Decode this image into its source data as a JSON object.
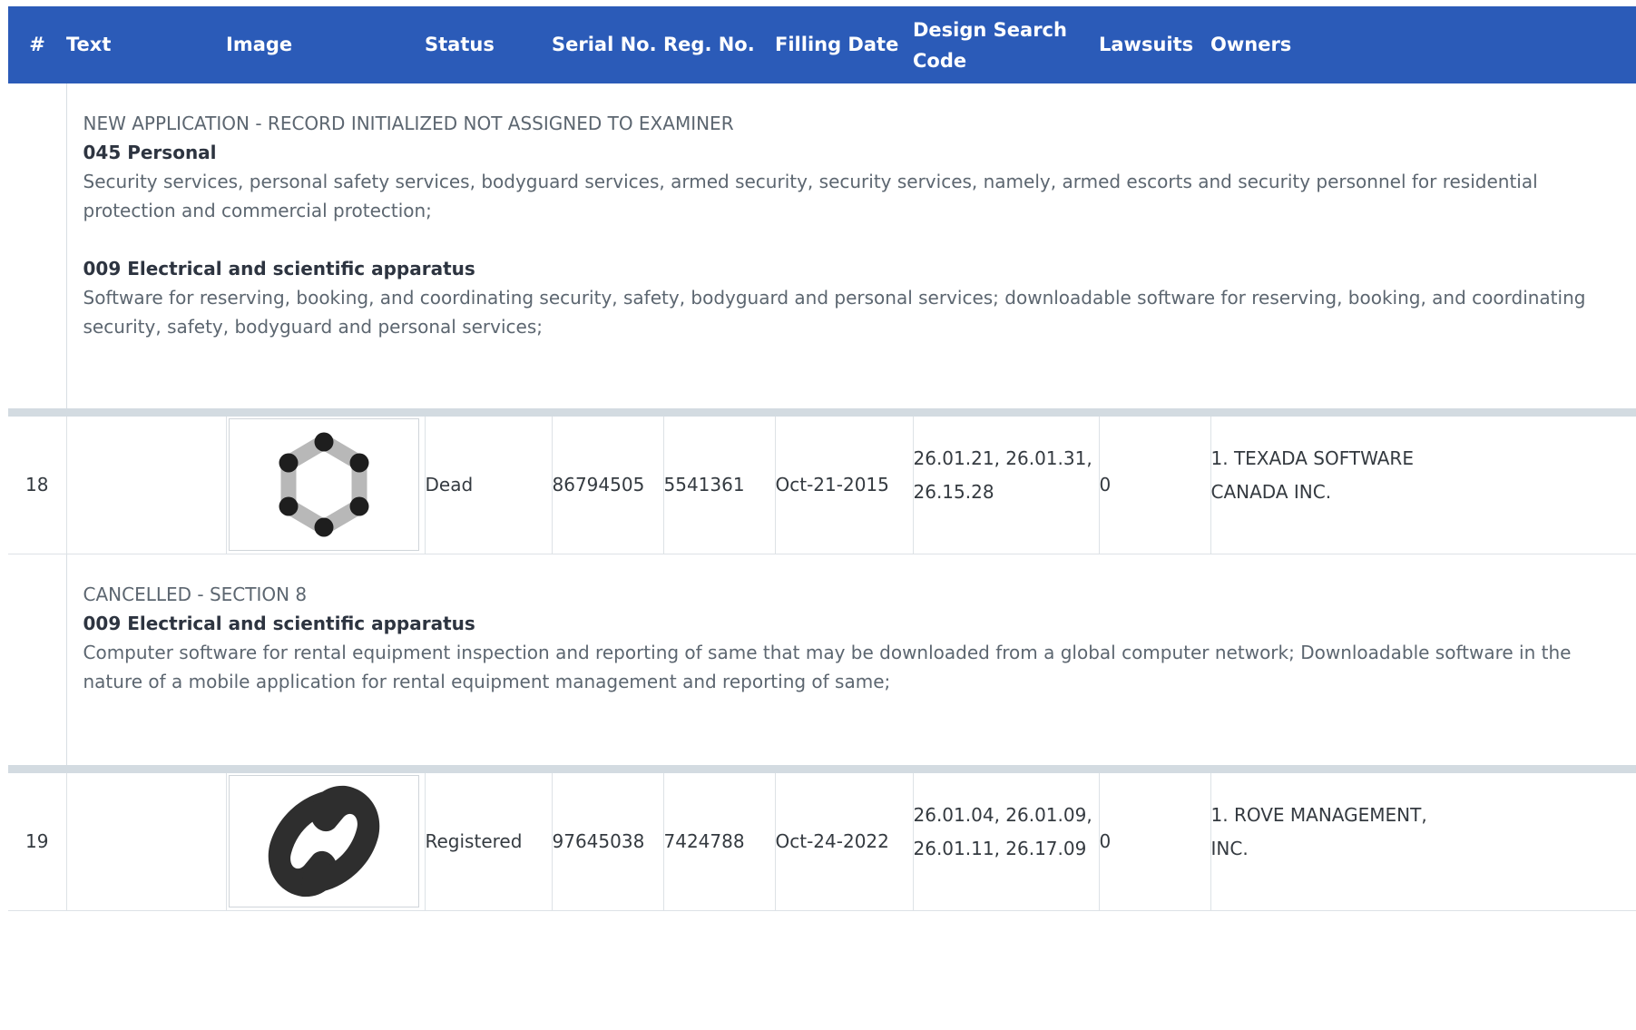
{
  "headers": {
    "num": "#",
    "text": "Text",
    "image": "Image",
    "status": "Status",
    "serial": "Serial No.",
    "reg": "Reg. No.",
    "filing": "Filling Date",
    "design_line1": "Design Search",
    "design_line2": "Code",
    "lawsuits": "Lawsuits",
    "owners": "Owners"
  },
  "details": [
    {
      "status_text": "NEW APPLICATION - RECORD INITIALIZED NOT ASSIGNED TO EXAMINER",
      "classes": [
        {
          "title": "045 Personal",
          "description": "Security services, personal safety services, bodyguard services, armed security, security services, namely, armed escorts and security personnel for residential protection and commercial protection;"
        },
        {
          "title": "009 Electrical and scientific apparatus",
          "description": "Software for reserving, booking, and coordinating security, safety, bodyguard and personal services; downloadable software for reserving, booking, and coordinating security, safety, bodyguard and personal services;"
        }
      ]
    },
    {
      "status_text": "CANCELLED - SECTION 8",
      "classes": [
        {
          "title": "009 Electrical and scientific apparatus",
          "description": "Computer software for rental equipment inspection and reporting of same that may be downloaded from a global computer network; Downloadable software in the nature of a mobile application for rental equipment management and reporting of same;"
        }
      ]
    }
  ],
  "rows": [
    {
      "num": "18",
      "text": "",
      "logo_icon": "hexagon-dots-logo-icon",
      "status": "Dead",
      "serial": "86794505",
      "reg": "5541361",
      "filing": "Oct-21-2015",
      "design_codes_line1": "26.01.21, 26.01.31,",
      "design_codes_line2": "26.15.28",
      "lawsuits": "0",
      "owner_line1": "1. TEXADA SOFTWARE",
      "owner_line2": "CANADA INC."
    },
    {
      "num": "19",
      "text": "",
      "logo_icon": "swirl-s-logo-icon",
      "status": "Registered",
      "serial": "97645038",
      "reg": "7424788",
      "filing": "Oct-24-2022",
      "design_codes_line1": "26.01.04, 26.01.09,",
      "design_codes_line2": "26.01.11, 26.17.09",
      "lawsuits": "0",
      "owner_line1": "1. ROVE MANAGEMENT,",
      "owner_line2": "INC."
    }
  ],
  "colors": {
    "header_bg": "#2b5bb8",
    "link": "#3b82e0",
    "registered": "#2fbe6a",
    "dead": "#adb5bd",
    "separator": "#d3dbe1"
  }
}
